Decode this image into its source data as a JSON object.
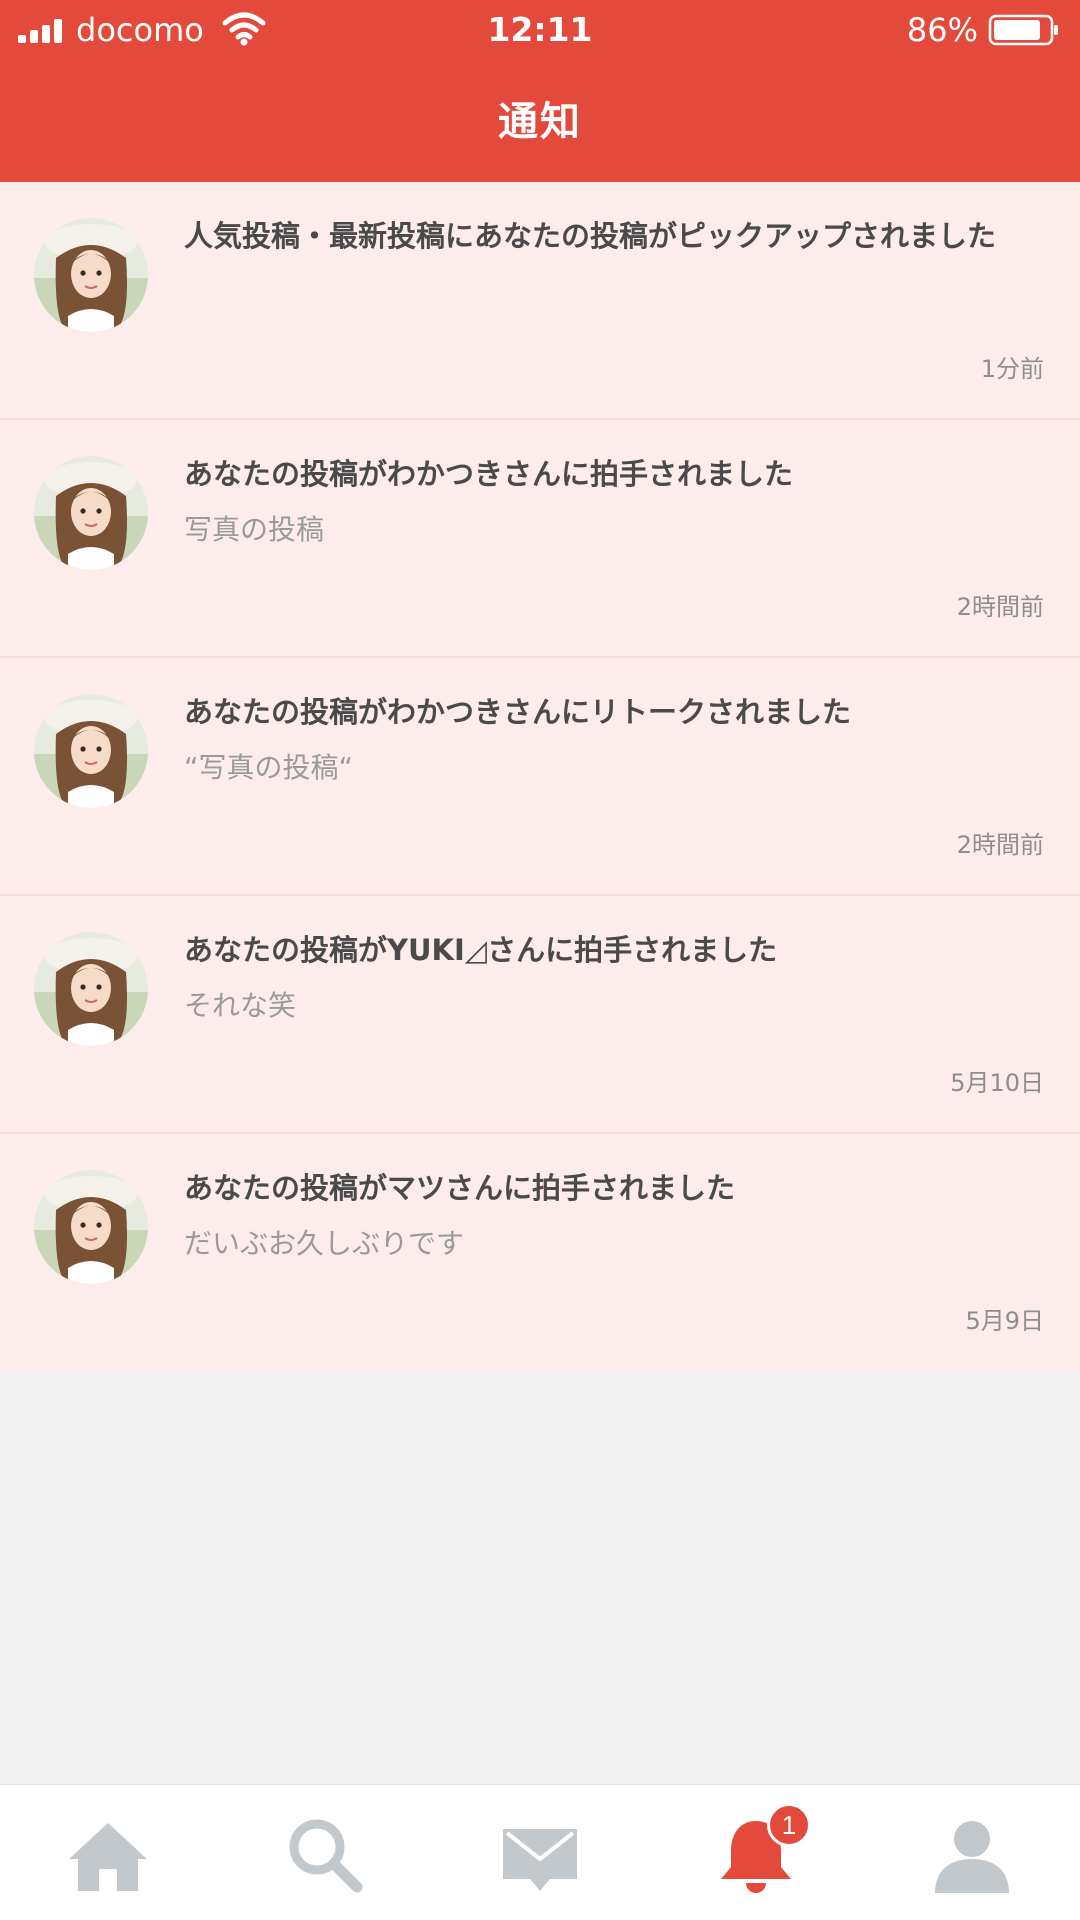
{
  "status_bar": {
    "carrier": "docomo",
    "time": "12:11",
    "battery": "86%",
    "battery_level": 0.86
  },
  "header": {
    "title": "通知"
  },
  "notifications": [
    {
      "title": "人気投稿・最新投稿にあなたの投稿がピックアップされました",
      "subtitle": "",
      "time": "1分前"
    },
    {
      "title": "あなたの投稿がわかつきさんに拍手されました",
      "subtitle": "写真の投稿",
      "time": "2時間前"
    },
    {
      "title": "あなたの投稿がわかつきさんにリトークされました",
      "subtitle": "“写真の投稿“",
      "time": "2時間前"
    },
    {
      "title": "あなたの投稿がYUKI◿さんに拍手されました",
      "subtitle": "それな笑",
      "time": "5月10日"
    },
    {
      "title": "あなたの投稿がマツさんに拍手されました",
      "subtitle": "だいぶお久しぶりです",
      "time": "5月9日"
    }
  ],
  "tabbar": {
    "items": [
      {
        "icon": "home-icon",
        "active": false
      },
      {
        "icon": "search-icon",
        "active": false
      },
      {
        "icon": "mail-icon",
        "active": false
      },
      {
        "icon": "bell-icon",
        "active": true,
        "badge": "1"
      },
      {
        "icon": "profile-icon",
        "active": false
      }
    ]
  },
  "colors": {
    "accent": "#e44a3c",
    "item_background": "#fdecec",
    "page_background": "#f1f1f1",
    "inactive_icon": "#c3c8cc"
  }
}
